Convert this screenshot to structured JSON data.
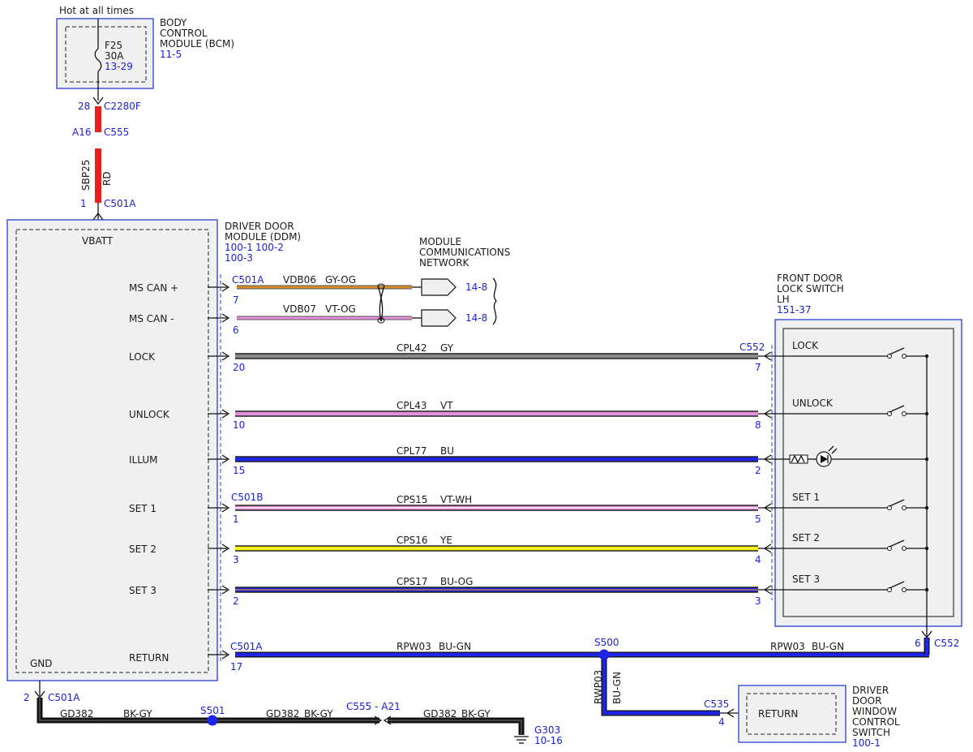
{
  "fuse_source": "Hot at all times",
  "fuse": {
    "id": "F25",
    "rating": "30A",
    "ref": "13-29"
  },
  "bcm": {
    "name_lines": [
      "BODY",
      "CONTROL",
      "MODULE (BCM)"
    ],
    "ref": "11-5"
  },
  "bcm_feed": {
    "pin_top": "28",
    "conn_top": "C2280F",
    "pin_mid": "A16",
    "conn_mid": "C555",
    "circuit": "SBP25",
    "color": "RD",
    "pin_bot": "1",
    "conn_bot": "C501A"
  },
  "ddm": {
    "name_lines": [
      "DRIVER DOOR",
      "MODULE (DDM)"
    ],
    "ref1": "100-1",
    "ref2": "100-2",
    "ref3": "100-3",
    "vbatt": "VBATT",
    "gnd": "GND"
  },
  "mcn": {
    "lines": [
      "MODULE",
      "COMMUNICATIONS",
      "NETWORK"
    ],
    "ref_hi": "14-8",
    "ref_lo": "14-8"
  },
  "switch_box": {
    "name_lines": [
      "FRONT DOOR",
      "LOCK SWITCH",
      "LH"
    ],
    "ref": "151-37"
  },
  "conn_c501a": "C501A",
  "conn_c501b": "C501B",
  "conn_c552": "C552",
  "circuits": [
    {
      "key": "mscan_hi",
      "label": "MS CAN +",
      "circuit": "VDB06",
      "color": "GY-OG",
      "ddm_pin": "7"
    },
    {
      "key": "mscan_lo",
      "label": "MS CAN -",
      "circuit": "VDB07",
      "color": "VT-OG",
      "ddm_pin": "6"
    },
    {
      "key": "lock",
      "label": "LOCK",
      "circuit": "CPL42",
      "color": "GY",
      "ddm_pin": "20",
      "sw_pin": "7",
      "sw_label": "LOCK"
    },
    {
      "key": "unlock",
      "label": "UNLOCK",
      "circuit": "CPL43",
      "color": "VT",
      "ddm_pin": "10",
      "sw_pin": "8",
      "sw_label": "UNLOCK"
    },
    {
      "key": "illum",
      "label": "ILLUM",
      "circuit": "CPL77",
      "color": "BU",
      "ddm_pin": "15",
      "sw_pin": "2"
    },
    {
      "key": "set1",
      "label": "SET 1",
      "circuit": "CPS15",
      "color": "VT-WH",
      "ddm_pin": "1",
      "sw_pin": "5",
      "sw_label": "SET 1"
    },
    {
      "key": "set2",
      "label": "SET 2",
      "circuit": "CPS16",
      "color": "YE",
      "ddm_pin": "3",
      "sw_pin": "4",
      "sw_label": "SET 2"
    },
    {
      "key": "set3",
      "label": "SET 3",
      "circuit": "CPS17",
      "color": "BU-OG",
      "ddm_pin": "2",
      "sw_pin": "3",
      "sw_label": "SET 3"
    }
  ],
  "return_circuit": {
    "label": "RETURN",
    "ddm_pin": "17",
    "conn": "C501A",
    "circuit_l": "RPW03",
    "color_l": "BU-GN",
    "splice": "S500",
    "circuit_r": "RPW03",
    "color_r": "BU-GN",
    "sw_pin": "6",
    "sw_conn": "C552",
    "branch_circuit": "RWP03",
    "branch_color": "BU-GN",
    "branch_conn": "C535",
    "branch_pin": "4"
  },
  "dwcs": {
    "return_label": "RETURN",
    "name_lines": [
      "DRIVER",
      "DOOR",
      "WINDOW",
      "CONTROL",
      "SWITCH"
    ],
    "ref": "100-1"
  },
  "ground": {
    "pin": "2",
    "conn": "C501A",
    "circuit_a": "GD382",
    "color_a": "BK-GY",
    "splice": "S501",
    "circuit_b": "GD382",
    "color_b": "BK-GY",
    "inline_conn": "C555 - A21",
    "circuit_c": "GD382",
    "color_c": "BK-GY",
    "ground_id": "G303",
    "ground_ref": "10-16"
  },
  "wire_colors": {
    "RD": "#e8211c",
    "GY": "#8a8a8a",
    "OG": "#d98a2b",
    "VT": "#e38fdc",
    "BU": "#1e24e8",
    "YE": "#f2ef1c",
    "WH": "#ffffff",
    "GN": "#2a9c3a",
    "BK": "#111111"
  }
}
